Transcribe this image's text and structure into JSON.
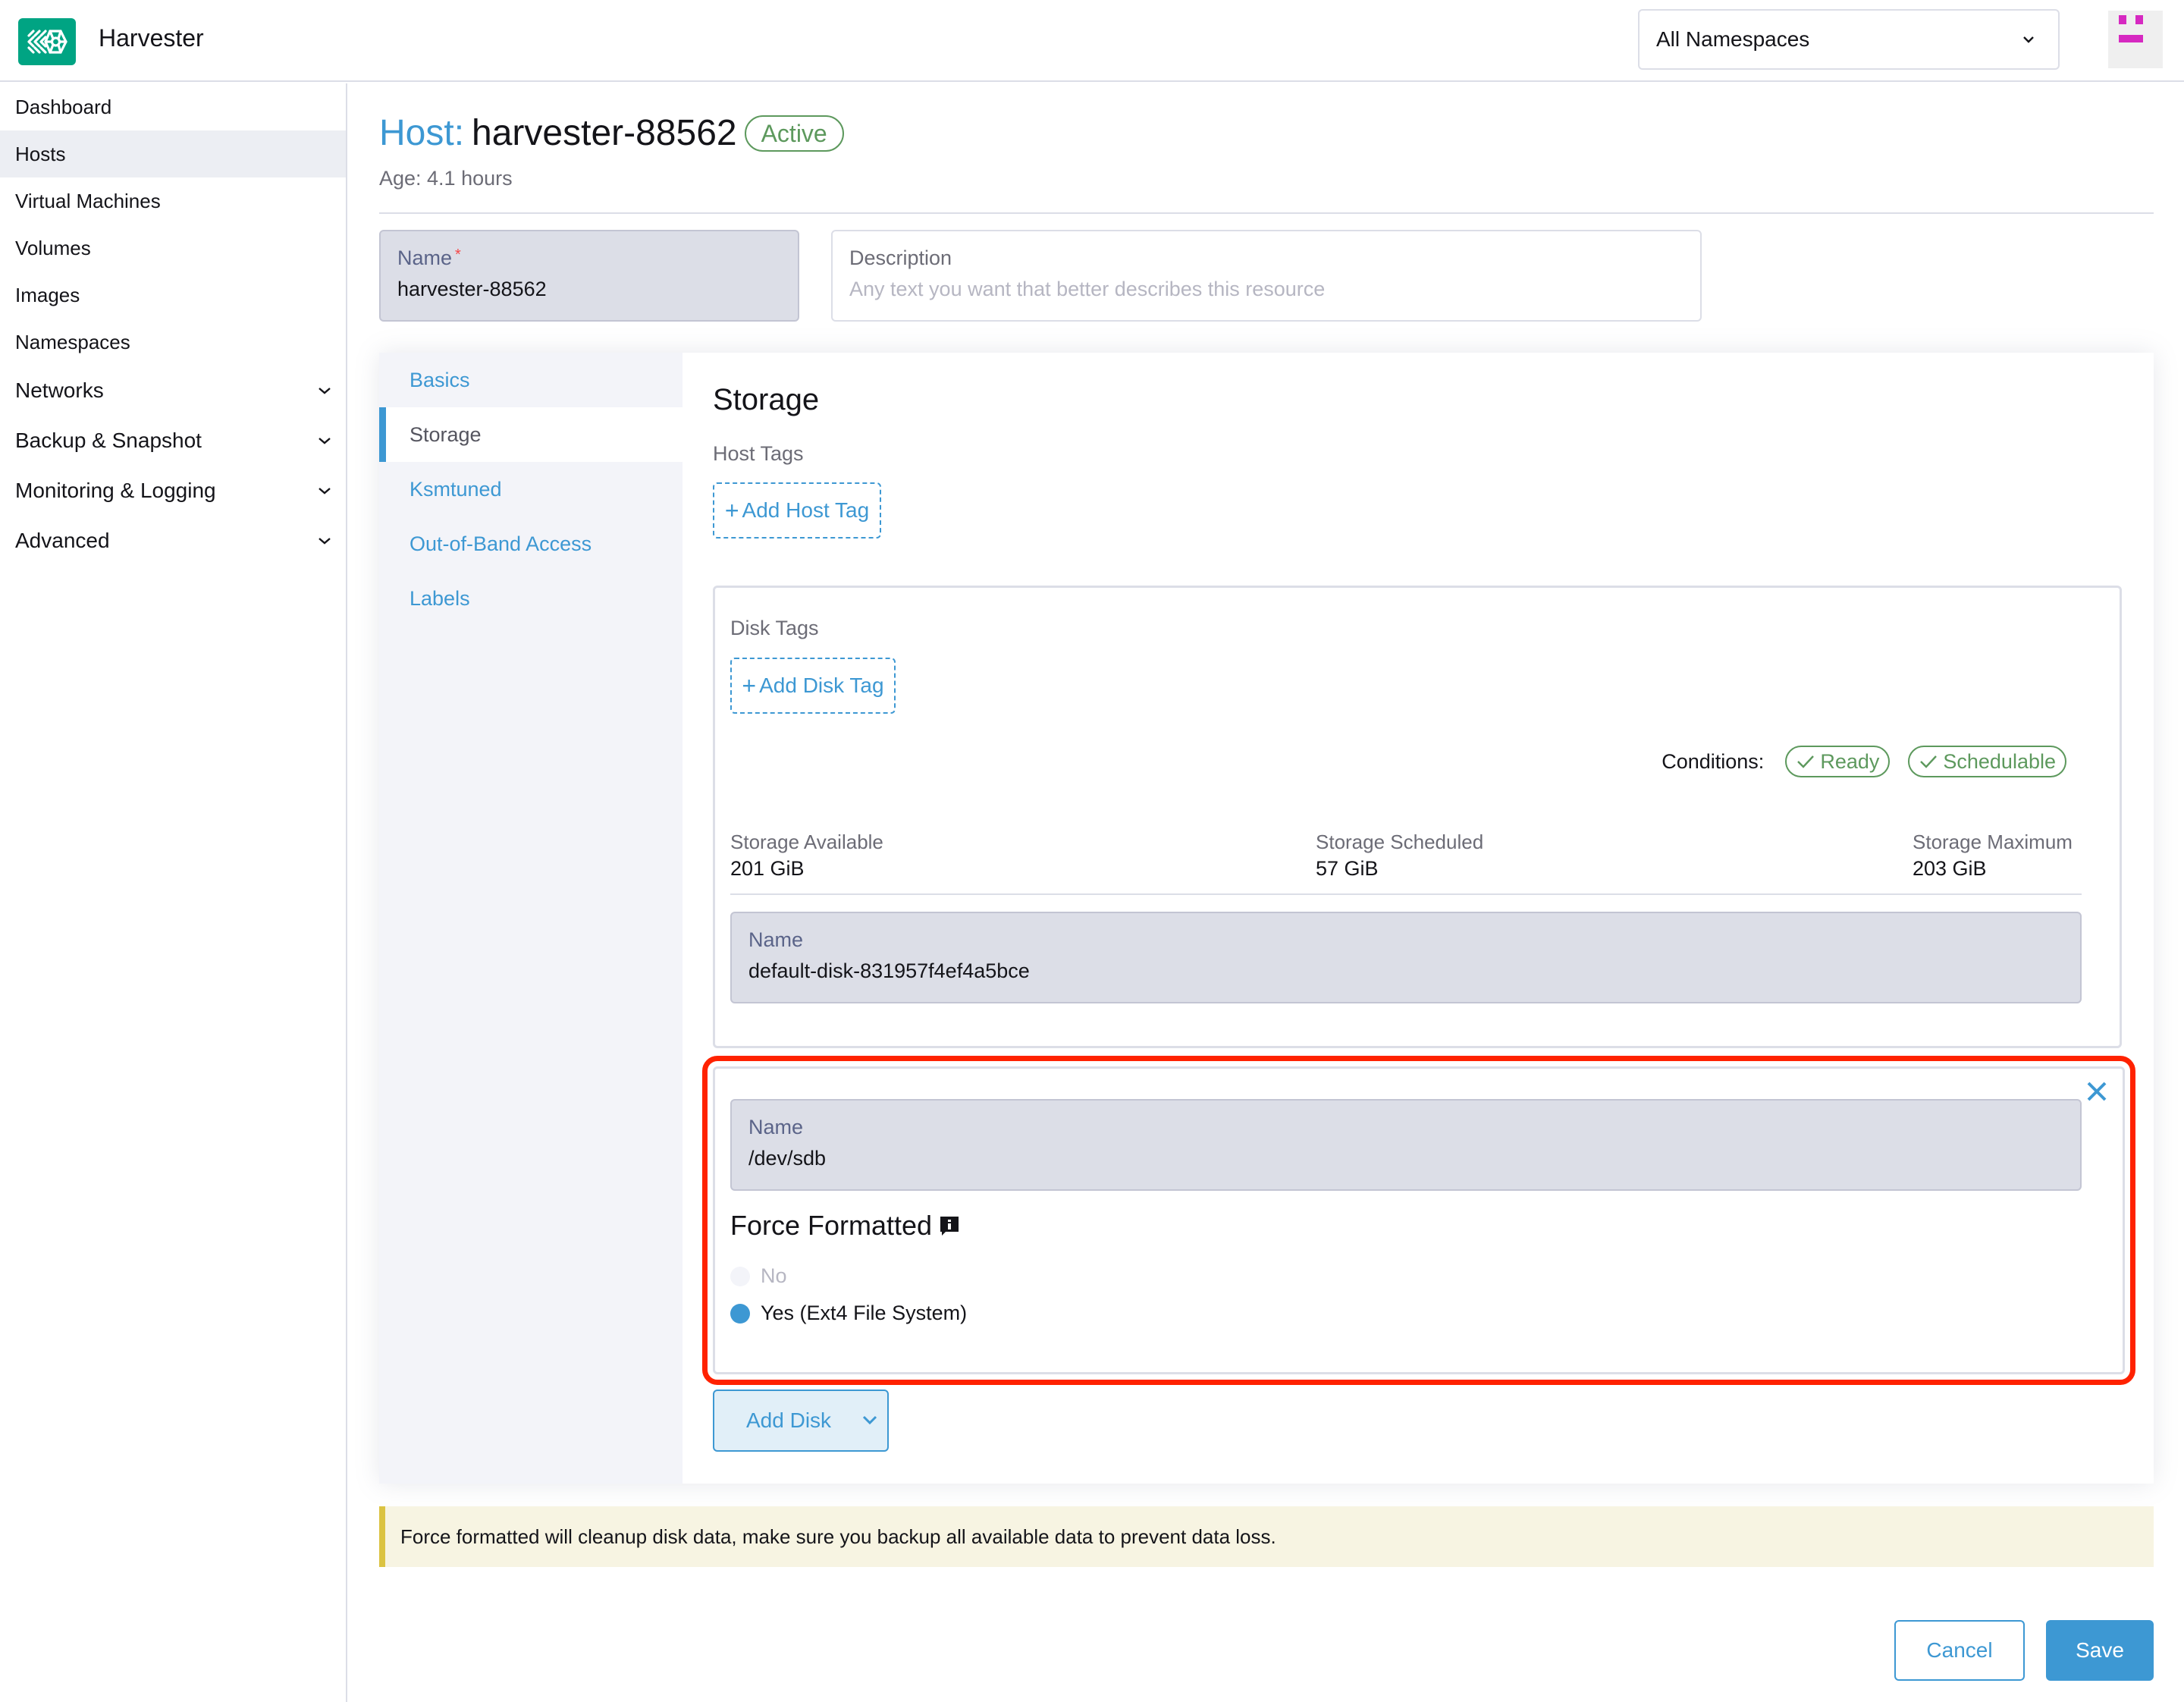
{
  "header": {
    "app_title": "Harvester",
    "namespace_selector": {
      "value": "All Namespaces"
    },
    "colors": {
      "brand": "#00a483",
      "avatar": "#d629c1"
    }
  },
  "sidebar": {
    "items": [
      {
        "label": "Dashboard",
        "active": false,
        "expandable": false
      },
      {
        "label": "Hosts",
        "active": true,
        "expandable": false
      },
      {
        "label": "Virtual Machines",
        "active": false,
        "expandable": false
      },
      {
        "label": "Volumes",
        "active": false,
        "expandable": false
      },
      {
        "label": "Images",
        "active": false,
        "expandable": false
      },
      {
        "label": "Namespaces",
        "active": false,
        "expandable": false
      },
      {
        "label": "Networks",
        "active": false,
        "expandable": true
      },
      {
        "label": "Backup & Snapshot",
        "active": false,
        "expandable": true
      },
      {
        "label": "Monitoring & Logging",
        "active": false,
        "expandable": true
      },
      {
        "label": "Advanced",
        "active": false,
        "expandable": true
      }
    ]
  },
  "page": {
    "title_prefix": "Host:",
    "title_name": "harvester-88562",
    "status": "Active",
    "age": "Age: 4.1 hours"
  },
  "form": {
    "name": {
      "label": "Name",
      "required_mark": "*",
      "value": "harvester-88562"
    },
    "description": {
      "label": "Description",
      "placeholder": "Any text you want that better describes this resource",
      "value": ""
    }
  },
  "tabs": [
    {
      "label": "Basics",
      "active": false
    },
    {
      "label": "Storage",
      "active": true
    },
    {
      "label": "Ksmtuned",
      "active": false
    },
    {
      "label": "Out-of-Band Access",
      "active": false
    },
    {
      "label": "Labels",
      "active": false
    }
  ],
  "storage": {
    "heading": "Storage",
    "host_tags_label": "Host Tags",
    "add_host_tag": "Add Host Tag",
    "existing_disk": {
      "disk_tags_label": "Disk Tags",
      "add_disk_tag": "Add Disk Tag",
      "conditions_label": "Conditions:",
      "conditions": [
        "Ready",
        "Schedulable"
      ],
      "stats": [
        {
          "label": "Storage Available",
          "value": "201 GiB"
        },
        {
          "label": "Storage Scheduled",
          "value": "57 GiB"
        },
        {
          "label": "Storage Maximum",
          "value": "203 GiB"
        }
      ],
      "name_label": "Name",
      "name_value": "default-disk-831957f4ef4a5bce"
    },
    "new_disk": {
      "name_label": "Name",
      "name_value": "/dev/sdb",
      "force_formatted_label": "Force Formatted",
      "options": [
        {
          "label": "No",
          "selected": false,
          "disabled": true
        },
        {
          "label": "Yes (Ext4 File System)",
          "selected": true,
          "disabled": false
        }
      ]
    },
    "add_disk": "Add Disk"
  },
  "banner": {
    "text": "Force formatted will cleanup disk data, make sure you backup all available data to prevent data loss."
  },
  "footer": {
    "cancel": "Cancel",
    "save": "Save"
  }
}
